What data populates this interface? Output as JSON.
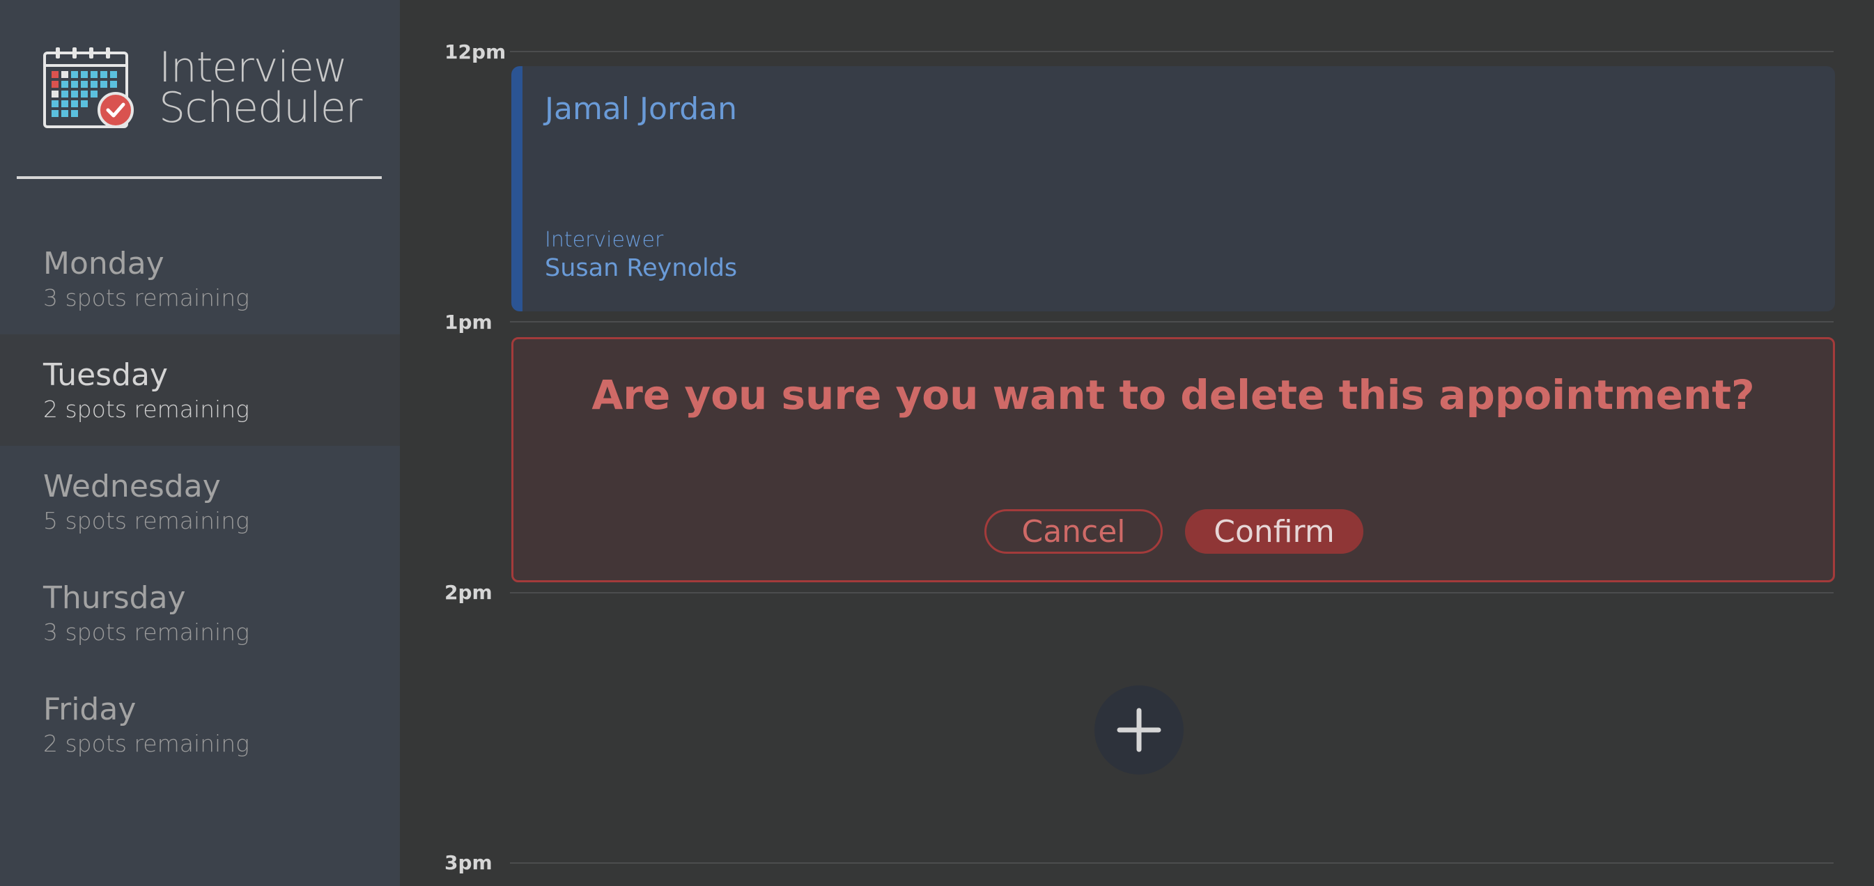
{
  "brand": {
    "logo_icon": "calendar-check-icon",
    "title_line1": "Interview",
    "title_line2": "Scheduler"
  },
  "days": [
    {
      "name": "Monday",
      "spots": "3 spots remaining",
      "selected": false
    },
    {
      "name": "Tuesday",
      "spots": "2 spots remaining",
      "selected": true
    },
    {
      "name": "Wednesday",
      "spots": "5 spots remaining",
      "selected": false
    },
    {
      "name": "Thursday",
      "spots": "3 spots remaining",
      "selected": false
    },
    {
      "name": "Friday",
      "spots": "2 spots remaining",
      "selected": false
    }
  ],
  "schedule": {
    "hours": [
      "12pm",
      "1pm",
      "2pm",
      "3pm"
    ],
    "appointment": {
      "student": "Jamal Jordan",
      "interviewer_label": "Interviewer",
      "interviewer": "Susan Reynolds"
    },
    "confirm": {
      "message": "Are you sure you want to delete this appointment?",
      "cancel_label": "Cancel",
      "confirm_label": "Confirm"
    },
    "add_icon": "plus-icon"
  },
  "colors": {
    "sidebar_bg": "#3c424b",
    "main_bg": "#363737",
    "appointment_accent": "#2b5493",
    "appointment_text": "#6a9bd8",
    "danger": "#a33b3b",
    "danger_text": "#cf6a67"
  }
}
